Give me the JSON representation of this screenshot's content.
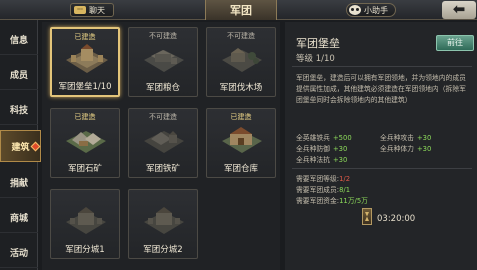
{
  "topbar": {
    "chat_label": "聊天",
    "title": "军团",
    "helper_label": "小助手",
    "back_icon": "back-arrow-icon"
  },
  "sidebar": {
    "items": [
      {
        "label": "信息"
      },
      {
        "label": "成员"
      },
      {
        "label": "科技"
      },
      {
        "label": "建筑",
        "active": true
      },
      {
        "label": "捐献"
      },
      {
        "label": "商城"
      },
      {
        "label": "活动"
      }
    ]
  },
  "buildings": [
    {
      "status": "已建造",
      "name": "军团堡垒1/10",
      "built": true,
      "selected": true
    },
    {
      "status": "不可建造",
      "name": "军团粮仓",
      "built": false
    },
    {
      "status": "不可建造",
      "name": "军团伐木场",
      "built": false
    },
    {
      "status": "已建造",
      "name": "军团石矿",
      "built": true
    },
    {
      "status": "不可建造",
      "name": "军团铁矿",
      "built": false
    },
    {
      "status": "已建造",
      "name": "军团仓库",
      "built": true
    },
    {
      "status": "",
      "name": "军团分城1",
      "built": false
    },
    {
      "status": "",
      "name": "军团分城2",
      "built": false
    }
  ],
  "detail": {
    "title": "军团堡垒",
    "level": "等级 1/10",
    "goto_label": "前往",
    "description": "军团堡垒，建造后可以拥有军团领地，并为领地内的成员提供属性加成，其他建筑必须建造在军团领地内（拆除军团堡垒同时会拆除领地内的其他建筑）",
    "stats": [
      {
        "label": "全英雄铁兵",
        "value": "+500"
      },
      {
        "label": "全兵种攻击",
        "value": "+30"
      },
      {
        "label": "全兵种防御",
        "value": "+30"
      },
      {
        "label": "全兵种体力",
        "value": "+30"
      },
      {
        "label": "全兵种法抗",
        "value": "+30"
      }
    ],
    "requirements": [
      {
        "label": "需要军团等级:",
        "value": "1/2",
        "ok": false
      },
      {
        "label": "需要军团成员:",
        "value": "8/1",
        "ok": true
      },
      {
        "label": "需要军团资金:",
        "value": "11万/5万",
        "ok": true
      }
    ],
    "timer": "03:20:00"
  }
}
